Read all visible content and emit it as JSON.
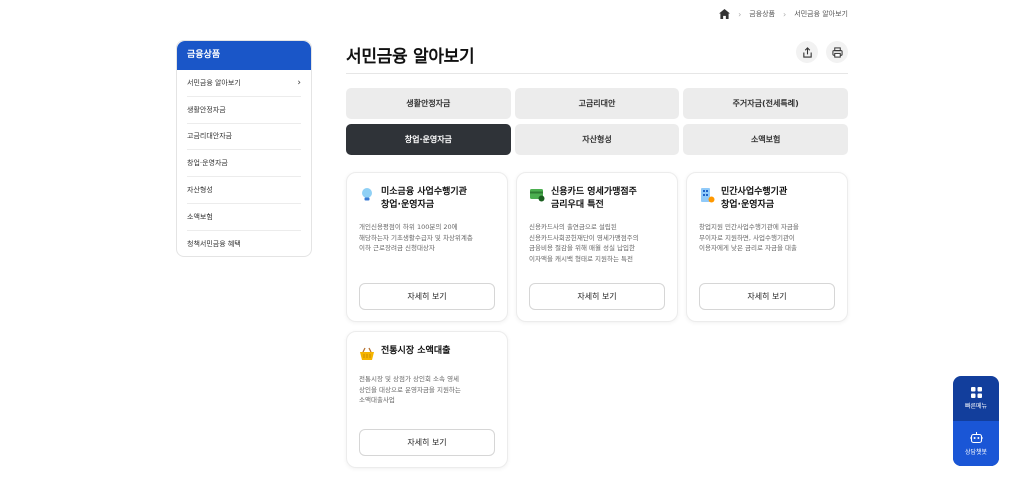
{
  "breadcrumb": {
    "items": [
      "금융상품",
      "서민금융 알아보기"
    ]
  },
  "sidebar": {
    "title": "금융상품",
    "items": [
      {
        "label": "서민금융 알아보기"
      },
      {
        "label": "생활안정자금"
      },
      {
        "label": "고금리대안자금"
      },
      {
        "label": "창업·운영자금"
      },
      {
        "label": "자산형성"
      },
      {
        "label": "소액보험"
      },
      {
        "label": "청책서민금융 혜택"
      }
    ]
  },
  "page": {
    "title": "서민금융 알아보기"
  },
  "categories": [
    {
      "label": "생활안정자금"
    },
    {
      "label": "고금리대안"
    },
    {
      "label": "주거자금(전세특례)"
    },
    {
      "label": "창업·운영자금"
    },
    {
      "label": "자산형성"
    },
    {
      "label": "소액보험"
    }
  ],
  "cards": [
    {
      "icon": "lightbulb-icon",
      "title1": "미소금융 사업수행기관",
      "title2": "창업·운영자금",
      "desc1": "개인신용평점이 하위 100분의 20에",
      "desc2": "해당하는자 기초생활수급자 및 차상위계층",
      "desc3": "이하 근로장려금 신청대상자",
      "button": "자세히 보기"
    },
    {
      "icon": "card-icon",
      "title1": "신용카드 영세가맹점주",
      "title2": "금리우대 특전",
      "desc1": "신용카드사의 출연금으로 설립된",
      "desc2": "신용카드사회공헌재단이 영세가맹점주의",
      "desc3": "금융비용 절감을 위해 매월 성실 납입한",
      "desc4": "이자액을 캐시백 형태로 지원하는 특전",
      "button": "자세히 보기"
    },
    {
      "icon": "building-icon",
      "title1": "민간사업수행기관",
      "title2": "창업·운영자금",
      "desc1": "창업지원 민간사업수행기관에 자금을",
      "desc2": "무이자로 지원하면, 사업수행기관이",
      "desc3": "이용자에게 낮은 금리로 자금을 대출",
      "button": "자세히 보기"
    },
    {
      "icon": "basket-icon",
      "title1": "전통시장 소액대출",
      "desc1": "전통시장 및 상점가 상인회 소속 영세",
      "desc2": "상인을 대상으로 운영자금을 지원하는",
      "desc3": "소액대출사업",
      "button": "자세히 보기"
    }
  ],
  "floating": {
    "quick_menu": "빠른메뉴",
    "chatbot": "상담챗봇"
  },
  "colors": {
    "brand": "#1a56c8",
    "active_tab": "#2f3338",
    "float_bg": "#123e9c"
  }
}
